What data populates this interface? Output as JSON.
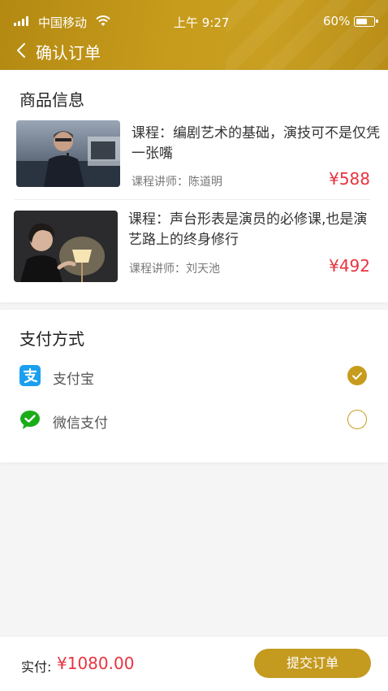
{
  "status_bar": {
    "carrier": "中国移动",
    "time": "上午 9:27",
    "battery": "60%",
    "battery_level": 0.6
  },
  "nav": {
    "title": "确认订单",
    "back_icon": "chevron-left-icon"
  },
  "goods": {
    "section_title": "商品信息",
    "items": [
      {
        "title": "课程：编剧艺术的基础，演技可不是仅凭一张嘴",
        "teacher": "课程讲师：陈道明",
        "price": "¥588"
      },
      {
        "title": "课程：声台形表是演员的必修课,也是演艺路上的终身修行",
        "teacher": "课程讲师：刘天池",
        "price": "¥492"
      }
    ]
  },
  "payment": {
    "section_title": "支付方式",
    "options": [
      {
        "label": "支付宝",
        "icon": "alipay-icon",
        "selected": true
      },
      {
        "label": "微信支付",
        "icon": "wechat-pay-icon",
        "selected": false
      }
    ]
  },
  "footer": {
    "total_label": "实付:",
    "total_amount": "¥1080.00",
    "submit_label": "提交订单"
  },
  "colors": {
    "accent": "#c79c1c",
    "price": "#e8343f",
    "alipay": "#1b9ff0",
    "wechat": "#1aad19"
  }
}
